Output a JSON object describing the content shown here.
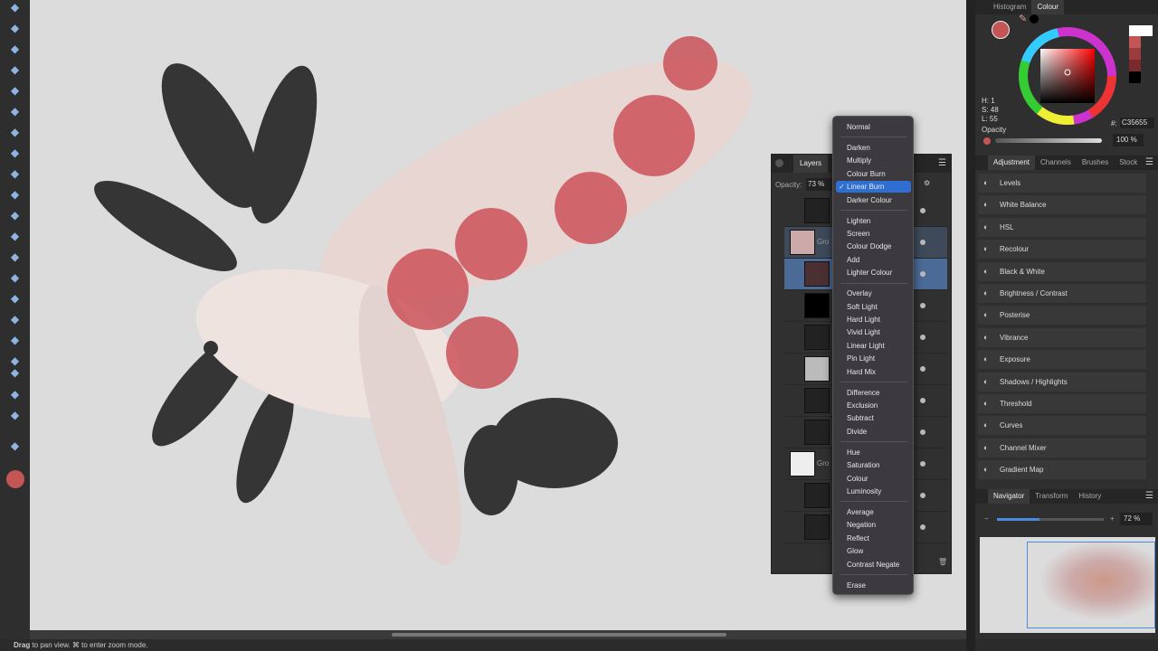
{
  "toolbar": {
    "tools": [
      "hand-icon",
      "move-icon",
      "eyedropper-icon",
      "crop-icon",
      "paint-mixer-icon",
      "magic-wand-icon",
      "marquee-icon",
      "flood-fill-icon",
      "paint-brush-icon",
      "pencil-icon",
      "healing-icon",
      "clone-icon",
      "dodge-icon",
      "stamp-icon",
      "smudge-icon",
      "levels-icon",
      "red-eye-icon",
      "node-icon",
      "rectangle-icon",
      "text-icon",
      "mesh-icon",
      "zoom-icon"
    ]
  },
  "status": {
    "bold": "Drag",
    "text": " to pan view. ⌘ to enter zoom mode."
  },
  "colour_panel": {
    "tabs": [
      "Histogram",
      "Colour"
    ],
    "h": "H: 1",
    "s": "S: 48",
    "l": "L: 55",
    "opacity_label": "Opacity",
    "hex_label": "#:",
    "hex": "C35655",
    "opacity_value": "100 %",
    "primary_color": "#C35655"
  },
  "adjustment_panel": {
    "tabs": [
      "Adjustment",
      "Channels",
      "Brushes",
      "Stock"
    ],
    "items": [
      "Levels",
      "White Balance",
      "HSL",
      "Recolour",
      "Black & White",
      "Brightness / Contrast",
      "Posterise",
      "Vibrance",
      "Exposure",
      "Shadows / Highlights",
      "Threshold",
      "Curves",
      "Channel Mixer",
      "Gradient Map"
    ]
  },
  "navigator": {
    "tabs": [
      "Navigator",
      "Transform",
      "History"
    ],
    "zoom": "72 %",
    "zoom_fraction": 0.4
  },
  "layers": {
    "title": "Layers",
    "opacity_label": "Opacity:",
    "opacity_value": "73 %",
    "group_label": "Gro"
  },
  "blend_menu": {
    "selected": "Linear Burn",
    "groups": [
      [
        "Normal"
      ],
      [
        "Darken",
        "Multiply",
        "Colour Burn",
        "Linear Burn",
        "Darker Colour"
      ],
      [
        "Lighten",
        "Screen",
        "Colour Dodge",
        "Add",
        "Lighter Colour"
      ],
      [
        "Overlay",
        "Soft Light",
        "Hard Light",
        "Vivid Light",
        "Linear Light",
        "Pin Light",
        "Hard Mix"
      ],
      [
        "Difference",
        "Exclusion",
        "Subtract",
        "Divide"
      ],
      [
        "Hue",
        "Saturation",
        "Colour",
        "Luminosity"
      ],
      [
        "Average",
        "Negation",
        "Reflect",
        "Glow",
        "Contrast Negate"
      ],
      [
        "Erase"
      ]
    ]
  }
}
